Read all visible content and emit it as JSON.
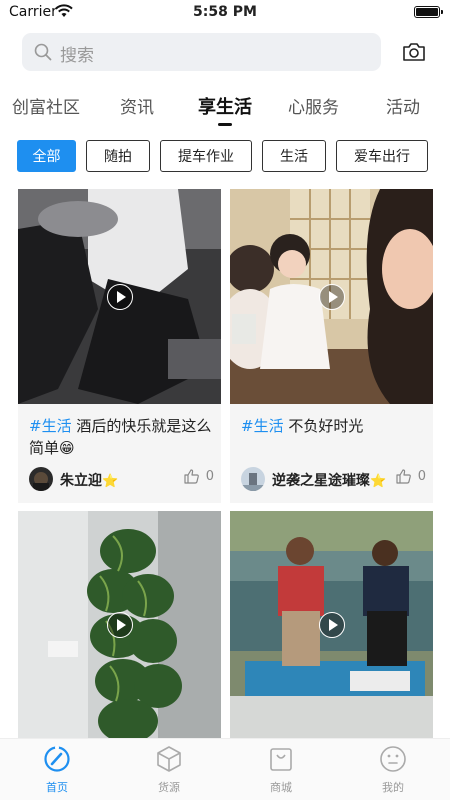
{
  "status": {
    "carrier": "Carrier",
    "time": "5:58 PM"
  },
  "search": {
    "placeholder": "搜索"
  },
  "tabs": [
    "创富社区",
    "资讯",
    "享生活",
    "心服务",
    "活动"
  ],
  "active_tab": "享生活",
  "chips": [
    "全部",
    "随拍",
    "提车作业",
    "生活",
    "爱车出行"
  ],
  "active_chip": "全部",
  "posts": [
    {
      "tag": "#生活",
      "text": " 酒后的快乐就是这么简单",
      "emoji": "😁",
      "author": "朱立迎",
      "verified": "⭐",
      "likes": "0"
    },
    {
      "tag": "#生活",
      "text": " 不负好时光",
      "emoji": "",
      "author": "逆袭之星途璀璨",
      "verified": "⭐",
      "likes": "0"
    },
    {
      "tag": "",
      "text": "",
      "emoji": "",
      "author": "",
      "verified": "",
      "likes": ""
    },
    {
      "tag": "",
      "text": "",
      "emoji": "",
      "author": "",
      "verified": "",
      "likes": ""
    }
  ],
  "bottom_nav": [
    {
      "label": "首页",
      "icon": "home-icon"
    },
    {
      "label": "货源",
      "icon": "box-icon"
    },
    {
      "label": "商城",
      "icon": "shopping-bag-icon"
    },
    {
      "label": "我的",
      "icon": "face-icon"
    }
  ],
  "active_bottom": "首页",
  "colors": {
    "accent": "#1e8ff0",
    "star": "#f4c01b"
  }
}
